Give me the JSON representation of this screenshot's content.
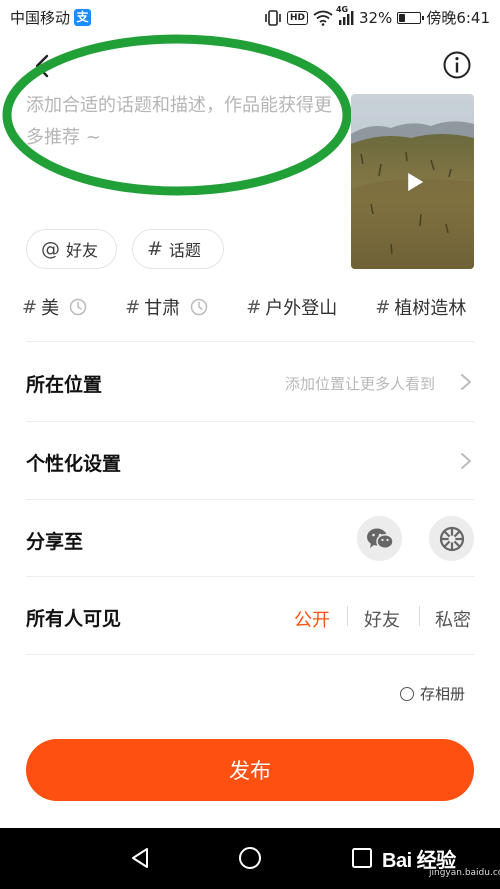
{
  "status_bar": {
    "carrier": "中国移动",
    "network": "4G",
    "battery": "32%",
    "battery_level": 0.32,
    "time": "傍晚6:41",
    "hd": "HD"
  },
  "compose": {
    "description_placeholder": "添加合适的话题和描述，作品能获得更多推荐 ~"
  },
  "chips": {
    "friends": "好友",
    "topic": "话题"
  },
  "topics": [
    {
      "label": "美",
      "recent": true
    },
    {
      "label": "甘肃",
      "recent": true
    },
    {
      "label": "户外登山",
      "recent": false
    },
    {
      "label": "植树造林",
      "recent": false
    }
  ],
  "rows": {
    "location_label": "所在位置",
    "location_hint": "添加位置让更多人看到",
    "personalize_label": "个性化设置",
    "share_label": "分享至",
    "visibility_label": "所有人可见"
  },
  "visibility": {
    "options": [
      "公开",
      "好友",
      "私密"
    ],
    "selected": "公开"
  },
  "save_album": "存相册",
  "publish": "发布",
  "watermark": {
    "brand": "Bai 经验",
    "sub": "jingyan.baidu.com"
  },
  "colors": {
    "accent": "#fe5010",
    "annotation_ring": "#22a038"
  }
}
